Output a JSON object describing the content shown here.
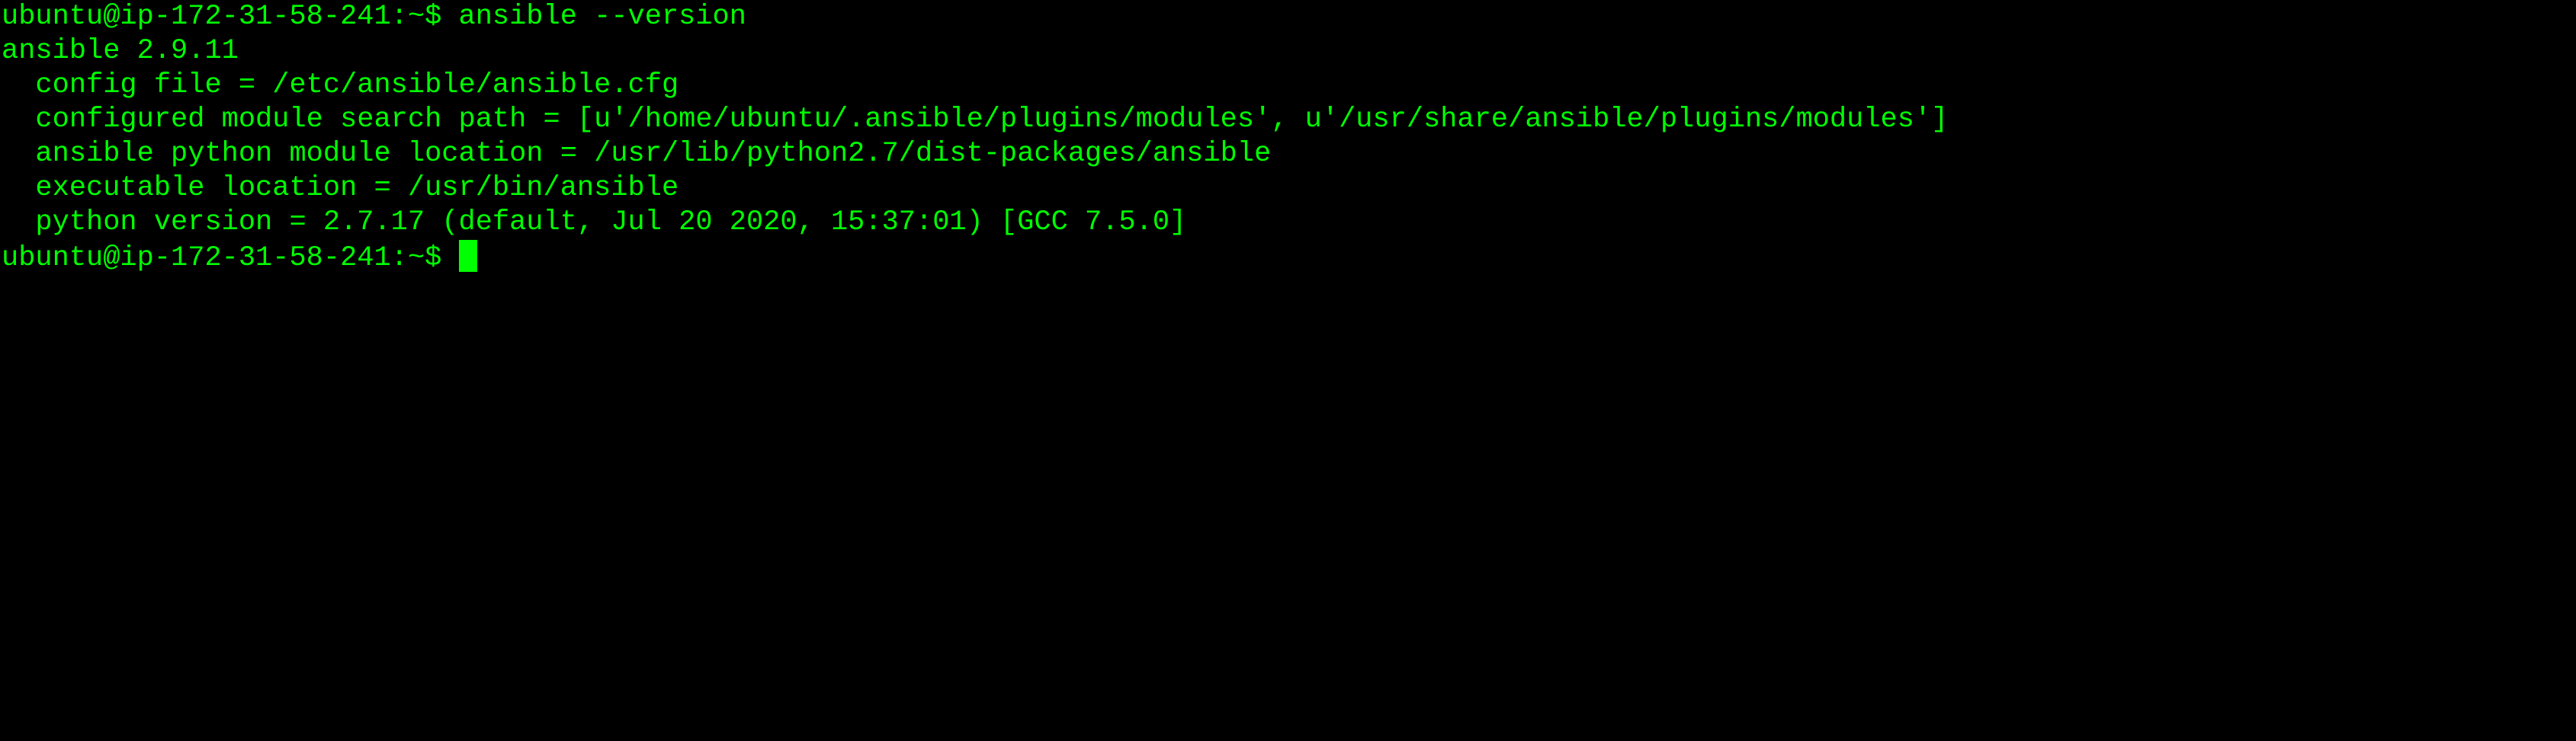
{
  "terminal": {
    "background_color": "#000000",
    "text_color": "#00ff00",
    "lines": [
      "ubuntu@ip-172-31-58-241:~$ ansible --version",
      "ansible 2.9.11",
      "  config file = /etc/ansible/ansible.cfg",
      "  configured module search path = [u'/home/ubuntu/.ansible/plugins/modules', u'/usr/share/ansible/plugins/modules']",
      "  ansible python module location = /usr/lib/python2.7/dist-packages/ansible",
      "  executable location = /usr/bin/ansible",
      "  python version = 2.7.17 (default, Jul 20 2020, 15:37:01) [GCC 7.5.0]"
    ],
    "prompt": "ubuntu@ip-172-31-58-241:~$ "
  }
}
